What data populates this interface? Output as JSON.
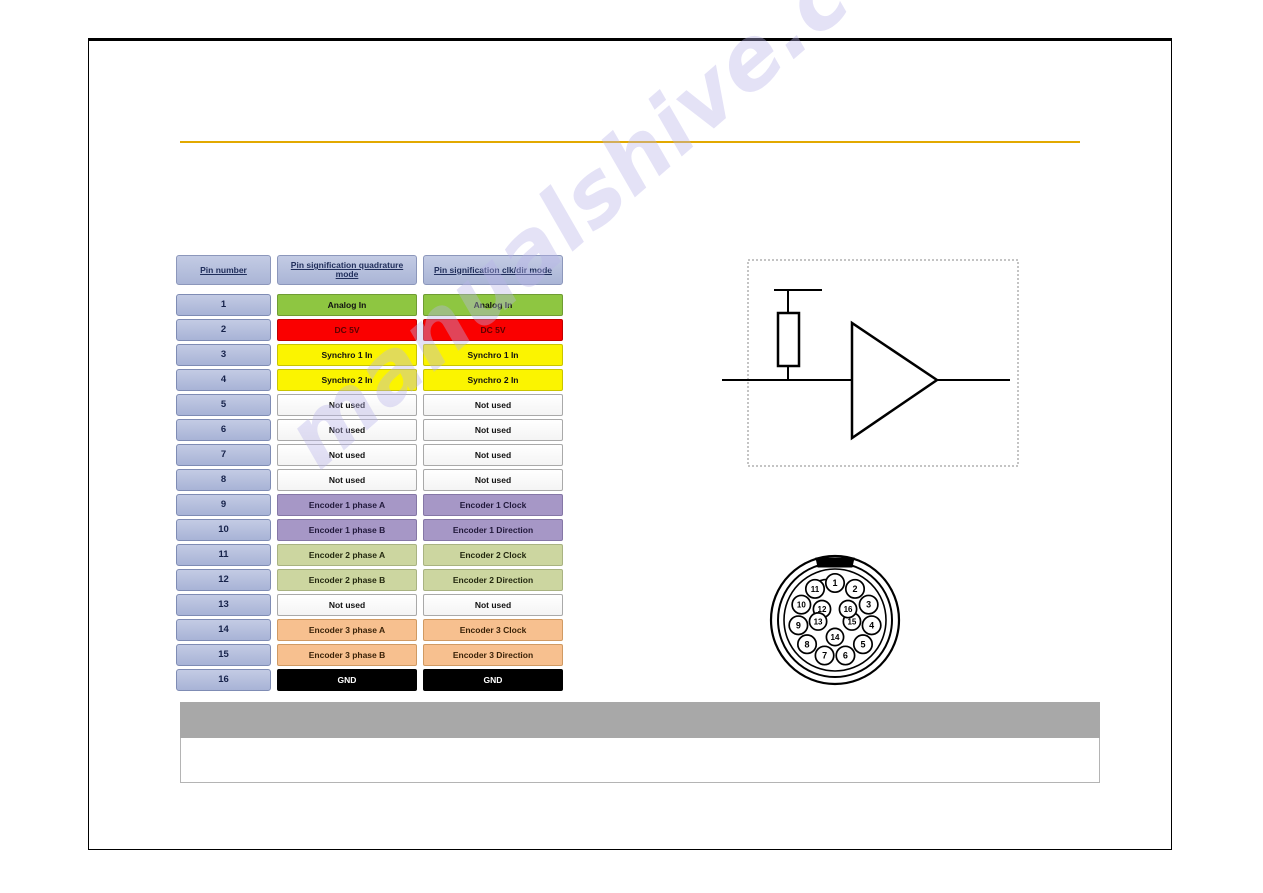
{
  "document": {
    "watermark_text": "manualshive.com",
    "accent_rule_color": "#e2a900",
    "frame_color": "#000000"
  },
  "table": {
    "headers": {
      "pin_number": "Pin number",
      "quadrature_mode": "Pin signification quadrature mode",
      "clk_dir_mode": "Pin signification clk/dir mode"
    },
    "rows": [
      {
        "pin": "1",
        "quad": "Analog In",
        "clk": "Analog In",
        "color": "green"
      },
      {
        "pin": "2",
        "quad": "DC 5V",
        "clk": "DC 5V",
        "color": "red"
      },
      {
        "pin": "3",
        "quad": "Synchro 1 In",
        "clk": "Synchro 1 In",
        "color": "yellow"
      },
      {
        "pin": "4",
        "quad": "Synchro 2 In",
        "clk": "Synchro 2 In",
        "color": "yellow"
      },
      {
        "pin": "5",
        "quad": "Not used",
        "clk": "Not used",
        "color": "white"
      },
      {
        "pin": "6",
        "quad": "Not used",
        "clk": "Not used",
        "color": "white"
      },
      {
        "pin": "7",
        "quad": "Not used",
        "clk": "Not used",
        "color": "white"
      },
      {
        "pin": "8",
        "quad": "Not used",
        "clk": "Not used",
        "color": "white"
      },
      {
        "pin": "9",
        "quad": "Encoder 1 phase A",
        "clk": "Encoder 1 Clock",
        "color": "purple"
      },
      {
        "pin": "10",
        "quad": "Encoder 1 phase B",
        "clk": "Encoder 1 Direction",
        "color": "purple"
      },
      {
        "pin": "11",
        "quad": "Encoder 2 phase A",
        "clk": "Encoder 2 Clock",
        "color": "olive"
      },
      {
        "pin": "12",
        "quad": "Encoder 2 phase B",
        "clk": "Encoder 2 Direction",
        "color": "olive"
      },
      {
        "pin": "13",
        "quad": "Not used",
        "clk": "Not used",
        "color": "white"
      },
      {
        "pin": "14",
        "quad": "Encoder 3 phase A",
        "clk": "Encoder 3 Clock",
        "color": "orange"
      },
      {
        "pin": "15",
        "quad": "Encoder 3 phase B",
        "clk": "Encoder 3 Direction",
        "color": "orange"
      },
      {
        "pin": "16",
        "quad": "GND",
        "clk": "GND",
        "color": "black"
      }
    ],
    "swatches": {
      "green": "#8ec641",
      "red": "#fa0000",
      "yellow": "#fbf400",
      "white": "#ffffff",
      "purple": "#a697c6",
      "olive": "#ccd6a0",
      "orange": "#f7c08f",
      "black": "#000000",
      "pin_column": "#aab5d6"
    }
  },
  "circuit": {
    "elements": [
      "supply-rail",
      "pull-up-resistor",
      "input-wire",
      "buffer-amplifier",
      "output-wire",
      "dashed-boundary"
    ]
  },
  "connector": {
    "type": "16-pin circular connector",
    "outer_ring_pins": [
      "1",
      "2",
      "3",
      "4",
      "5",
      "6",
      "7",
      "8",
      "9",
      "10",
      "11"
    ],
    "inner_ring_pins": [
      "12",
      "13",
      "14",
      "15",
      "16"
    ],
    "has_key_notch": true
  },
  "bottom_panel": {
    "bar_color": "#a8a8a8",
    "body_color": "#ffffff"
  }
}
